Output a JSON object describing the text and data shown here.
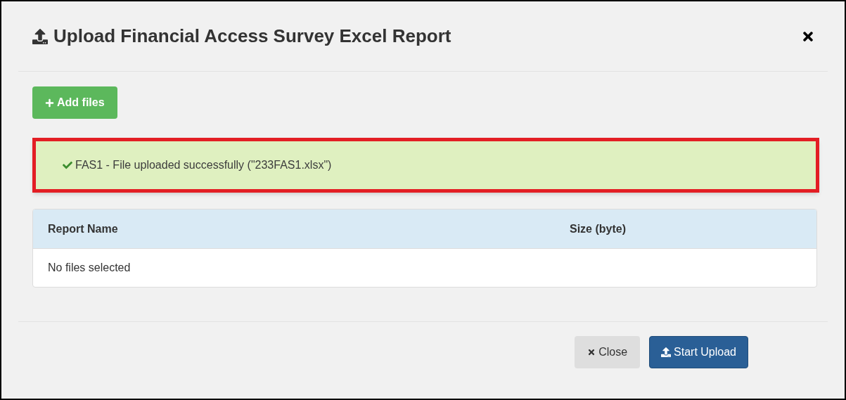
{
  "dialog": {
    "title": "Upload Financial Access Survey Excel Report"
  },
  "add_button": {
    "label": "Add files"
  },
  "alert": {
    "message": "FAS1 - File uploaded successfully (\"233FAS1.xlsx\")",
    "highlighted": true
  },
  "table": {
    "columns": [
      "Report Name",
      "Size (byte)"
    ],
    "empty_text": "No files selected"
  },
  "buttons": [
    {
      "kind": "default",
      "label": "Close"
    },
    {
      "kind": "primary",
      "label": "Start Upload"
    }
  ]
}
